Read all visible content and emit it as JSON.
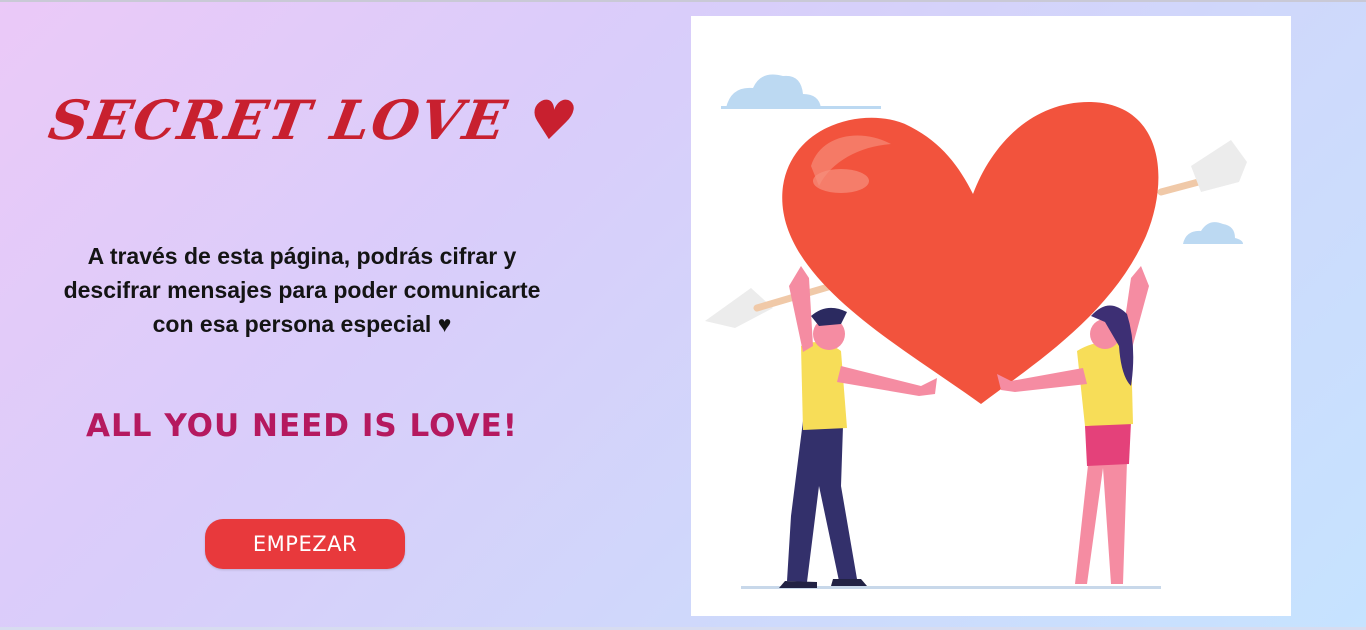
{
  "header": {
    "title": "SECRET LOVE ♥"
  },
  "intro": {
    "description": "A través de esta página, podrás cifrar y descifrar mensajes para poder comunicarte con esa persona especial ♥",
    "motto": "ALL YOU NEED IS LOVE!"
  },
  "actions": {
    "start_label": "EMPEZAR"
  },
  "illustration": {
    "subject": "couple holding heart pierced by arrow",
    "icons": [
      "heart-icon",
      "arrow-icon",
      "cloud-icon"
    ]
  },
  "colors": {
    "title": "#c8202f",
    "motto": "#b5195f",
    "button": "#e8393c",
    "heart": "#f2533d"
  }
}
